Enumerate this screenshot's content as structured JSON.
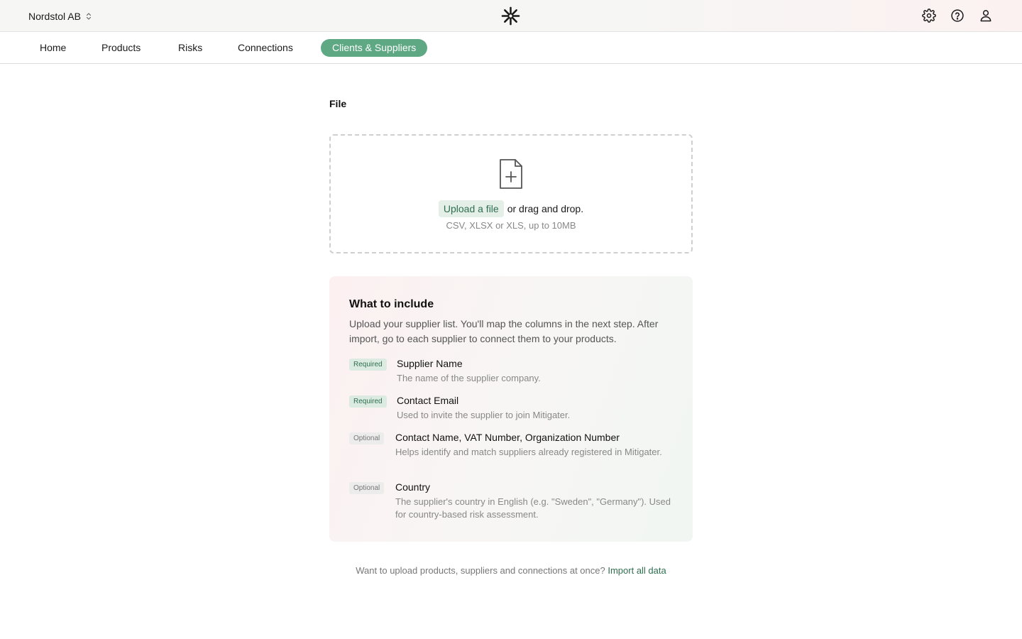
{
  "header": {
    "org_name": "Nordstol AB",
    "icons": [
      "chevron-updown-icon",
      "logo-mark",
      "settings-icon",
      "help-icon",
      "user-icon"
    ]
  },
  "nav": {
    "tabs": [
      {
        "label": "Home",
        "active": false
      },
      {
        "label": "Products",
        "active": false
      },
      {
        "label": "Risks",
        "active": false
      },
      {
        "label": "Connections",
        "active": false
      },
      {
        "label": "Clients & Suppliers",
        "active": true
      }
    ]
  },
  "main": {
    "section_title": "File",
    "dropzone": {
      "upload_label": "Upload a file",
      "drag_text": "or drag and drop.",
      "hint": "CSV, XLSX or XLS, up to 10MB"
    },
    "include": {
      "title": "What to include",
      "description": "Upload your supplier list. You'll map the columns in the next step. After import, go to each supplier to connect them to your products.",
      "fields": [
        {
          "badge": "Required",
          "name": "Supplier Name",
          "desc": "The name of the supplier company."
        },
        {
          "badge": "Required",
          "name": "Contact Email",
          "desc": "Used to invite the supplier to join Mitigater."
        },
        {
          "badge": "Optional",
          "name": "Contact Name, VAT Number, Organization Number",
          "desc": "Helps identify and match suppliers already registered in Mitigater."
        },
        {
          "badge": "Optional",
          "name": "Country",
          "desc": "The supplier's country in English (e.g. \"Sweden\", \"Germany\"). Used for country-based risk assessment."
        }
      ]
    },
    "footer": {
      "text": "Want to upload products, suppliers and connections at once?",
      "link": "Import all data"
    }
  },
  "colors": {
    "accent": "#5fa884",
    "accent_text": "#2f6e4f",
    "required_badge_bg": "#dcebe1",
    "optional_badge_bg": "#ececec"
  }
}
